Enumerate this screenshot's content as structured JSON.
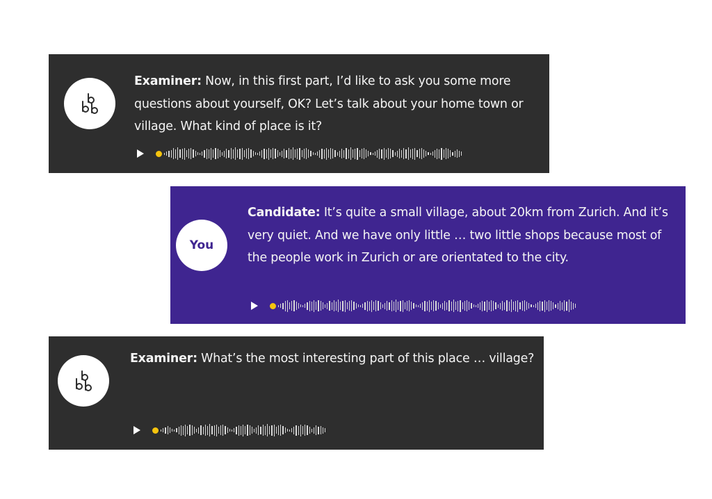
{
  "messages": [
    {
      "role": "examiner",
      "speaker": "Examiner:",
      "text": " Now, in this first part, I’d like to ask you some more questions about yourself, OK? Let’s talk about your home town or village. What kind of place is it?",
      "avatar_icon": "bbb-logo-icon"
    },
    {
      "role": "candidate",
      "speaker": "Candidate:",
      "text": " It’s quite a small village, about 20km from Zurich. And it’s very quiet. And we have only little … two little shops because most of the people work in Zurich or are orientated to the city.",
      "avatar_label": "You"
    },
    {
      "role": "examiner",
      "speaker": "Examiner:",
      "text": " What’s the most interesting part of this place … village?",
      "avatar_icon": "bbb-logo-icon"
    }
  ],
  "colors": {
    "examiner_background": "#2e2e2e",
    "candidate_background": "#3f2590",
    "progress_dot": "#f6c40e",
    "waveform": "#d9d9d9"
  },
  "icons": {
    "play": "play-icon",
    "progress": "yellow-dot",
    "waveform": "audio-waveform-icon"
  },
  "audio_progress": [
    0,
    0,
    0
  ]
}
